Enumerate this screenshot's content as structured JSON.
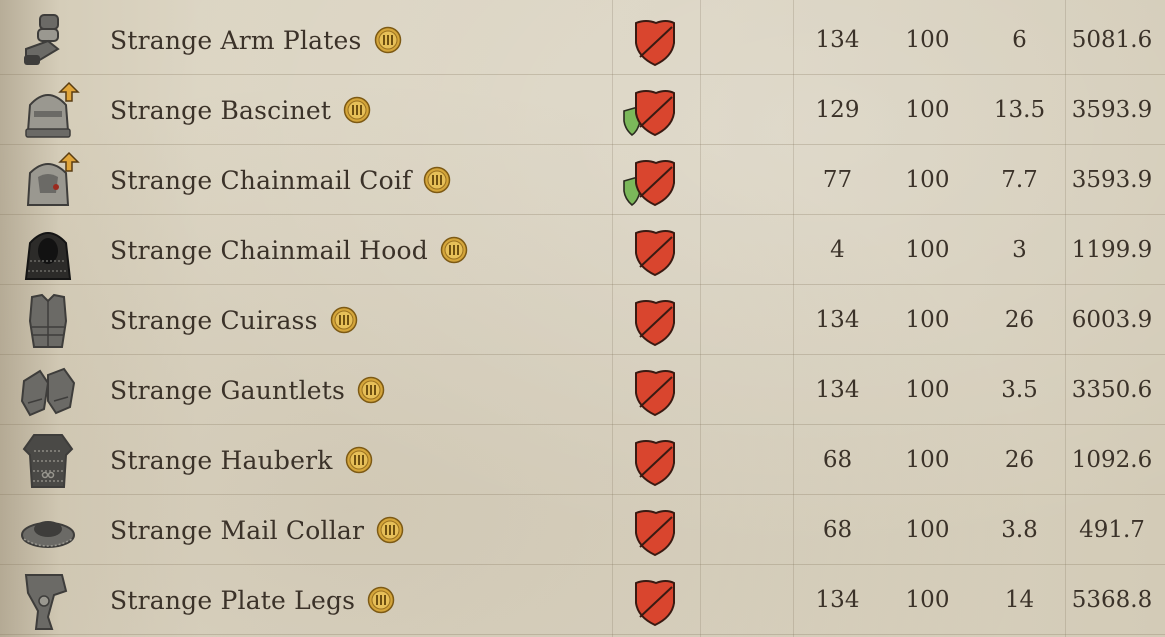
{
  "colors": {
    "shield_red": "#d9452e",
    "shield_green": "#7bb85a",
    "coin_gold": "#c99a2e",
    "text": "#3b3229"
  },
  "rows": [
    {
      "name": "Strange Arm Plates",
      "icon": "arm-plates-icon",
      "upgrade": false,
      "extra_shield": false,
      "v1": "134",
      "v2": "100",
      "v3": "6",
      "v4": "5081.6"
    },
    {
      "name": "Strange Bascinet",
      "icon": "bascinet-icon",
      "upgrade": true,
      "extra_shield": true,
      "v1": "129",
      "v2": "100",
      "v3": "13.5",
      "v4": "3593.9"
    },
    {
      "name": "Strange Chainmail Coif",
      "icon": "chainmail-coif-icon",
      "upgrade": true,
      "extra_shield": true,
      "v1": "77",
      "v2": "100",
      "v3": "7.7",
      "v4": "3593.9"
    },
    {
      "name": "Strange Chainmail Hood",
      "icon": "chainmail-hood-icon",
      "upgrade": false,
      "extra_shield": false,
      "v1": "4",
      "v2": "100",
      "v3": "3",
      "v4": "1199.9"
    },
    {
      "name": "Strange Cuirass",
      "icon": "cuirass-icon",
      "upgrade": false,
      "extra_shield": false,
      "v1": "134",
      "v2": "100",
      "v3": "26",
      "v4": "6003.9"
    },
    {
      "name": "Strange Gauntlets",
      "icon": "gauntlets-icon",
      "upgrade": false,
      "extra_shield": false,
      "v1": "134",
      "v2": "100",
      "v3": "3.5",
      "v4": "3350.6"
    },
    {
      "name": "Strange Hauberk",
      "icon": "hauberk-icon",
      "upgrade": false,
      "extra_shield": false,
      "v1": "68",
      "v2": "100",
      "v3": "26",
      "v4": "1092.6"
    },
    {
      "name": "Strange Mail Collar",
      "icon": "mail-collar-icon",
      "upgrade": false,
      "extra_shield": false,
      "v1": "68",
      "v2": "100",
      "v3": "3.8",
      "v4": "491.7"
    },
    {
      "name": "Strange Plate Legs",
      "icon": "plate-legs-icon",
      "upgrade": false,
      "extra_shield": false,
      "v1": "134",
      "v2": "100",
      "v3": "14",
      "v4": "5368.8"
    }
  ]
}
